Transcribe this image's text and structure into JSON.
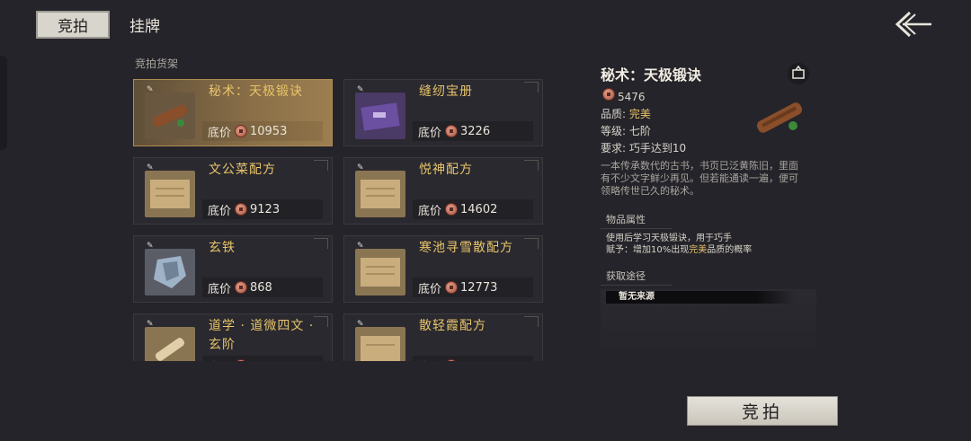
{
  "tabs": {
    "auction": "竞拍",
    "listing": "挂牌"
  },
  "section_label": "竞拍货架",
  "price_label": "底价",
  "items": [
    {
      "name": "秘术：天极锻诀",
      "price": "10953",
      "icon": "scroll-bundle-icon",
      "selected": true
    },
    {
      "name": "缝纫宝册",
      "price": "3226",
      "icon": "purple-book-icon",
      "selected": false
    },
    {
      "name": "文公菜配方",
      "price": "9123",
      "icon": "recipe-scroll-icon",
      "selected": false
    },
    {
      "name": "悦神配方",
      "price": "14602",
      "icon": "recipe-scroll-icon",
      "selected": false
    },
    {
      "name": "玄铁",
      "price": "868",
      "icon": "iron-ore-icon",
      "selected": false
    },
    {
      "name": "寒池寻雪散配方",
      "price": "12773",
      "icon": "recipe-scroll-icon",
      "selected": false
    },
    {
      "name": "道学 · 道微四文 · 玄阶",
      "price": "",
      "icon": "rolled-scroll-icon",
      "selected": false
    },
    {
      "name": "散轻霞配方",
      "price": "",
      "icon": "recipe-scroll-icon",
      "selected": false
    }
  ],
  "detail": {
    "title": "秘术：天极锻诀",
    "price": "5476",
    "quality_label": "品质:",
    "quality": "完美",
    "grade": "等级: 七阶",
    "requirement": "要求: 巧手达到10",
    "description": "一本传承数代的古书，书页已泛黄陈旧，里面有不少文字鲜少再见。但若能通读一遍，便可领略传世已久的秘术。",
    "attr_title": "物品属性",
    "attr_line1": "使用后学习天极锻诀，用于巧手",
    "attr_line2_prefix": "赋予：增加10%出现",
    "attr_line2_quality": "完美",
    "attr_line2_suffix": "品质的概率",
    "source_title": "获取途径",
    "source": "暂无来源"
  },
  "bid_button": "竞拍",
  "colors": {
    "quality_gold": "#e8c46a",
    "selected_card": "#8a6f48",
    "background": "#25242a"
  }
}
